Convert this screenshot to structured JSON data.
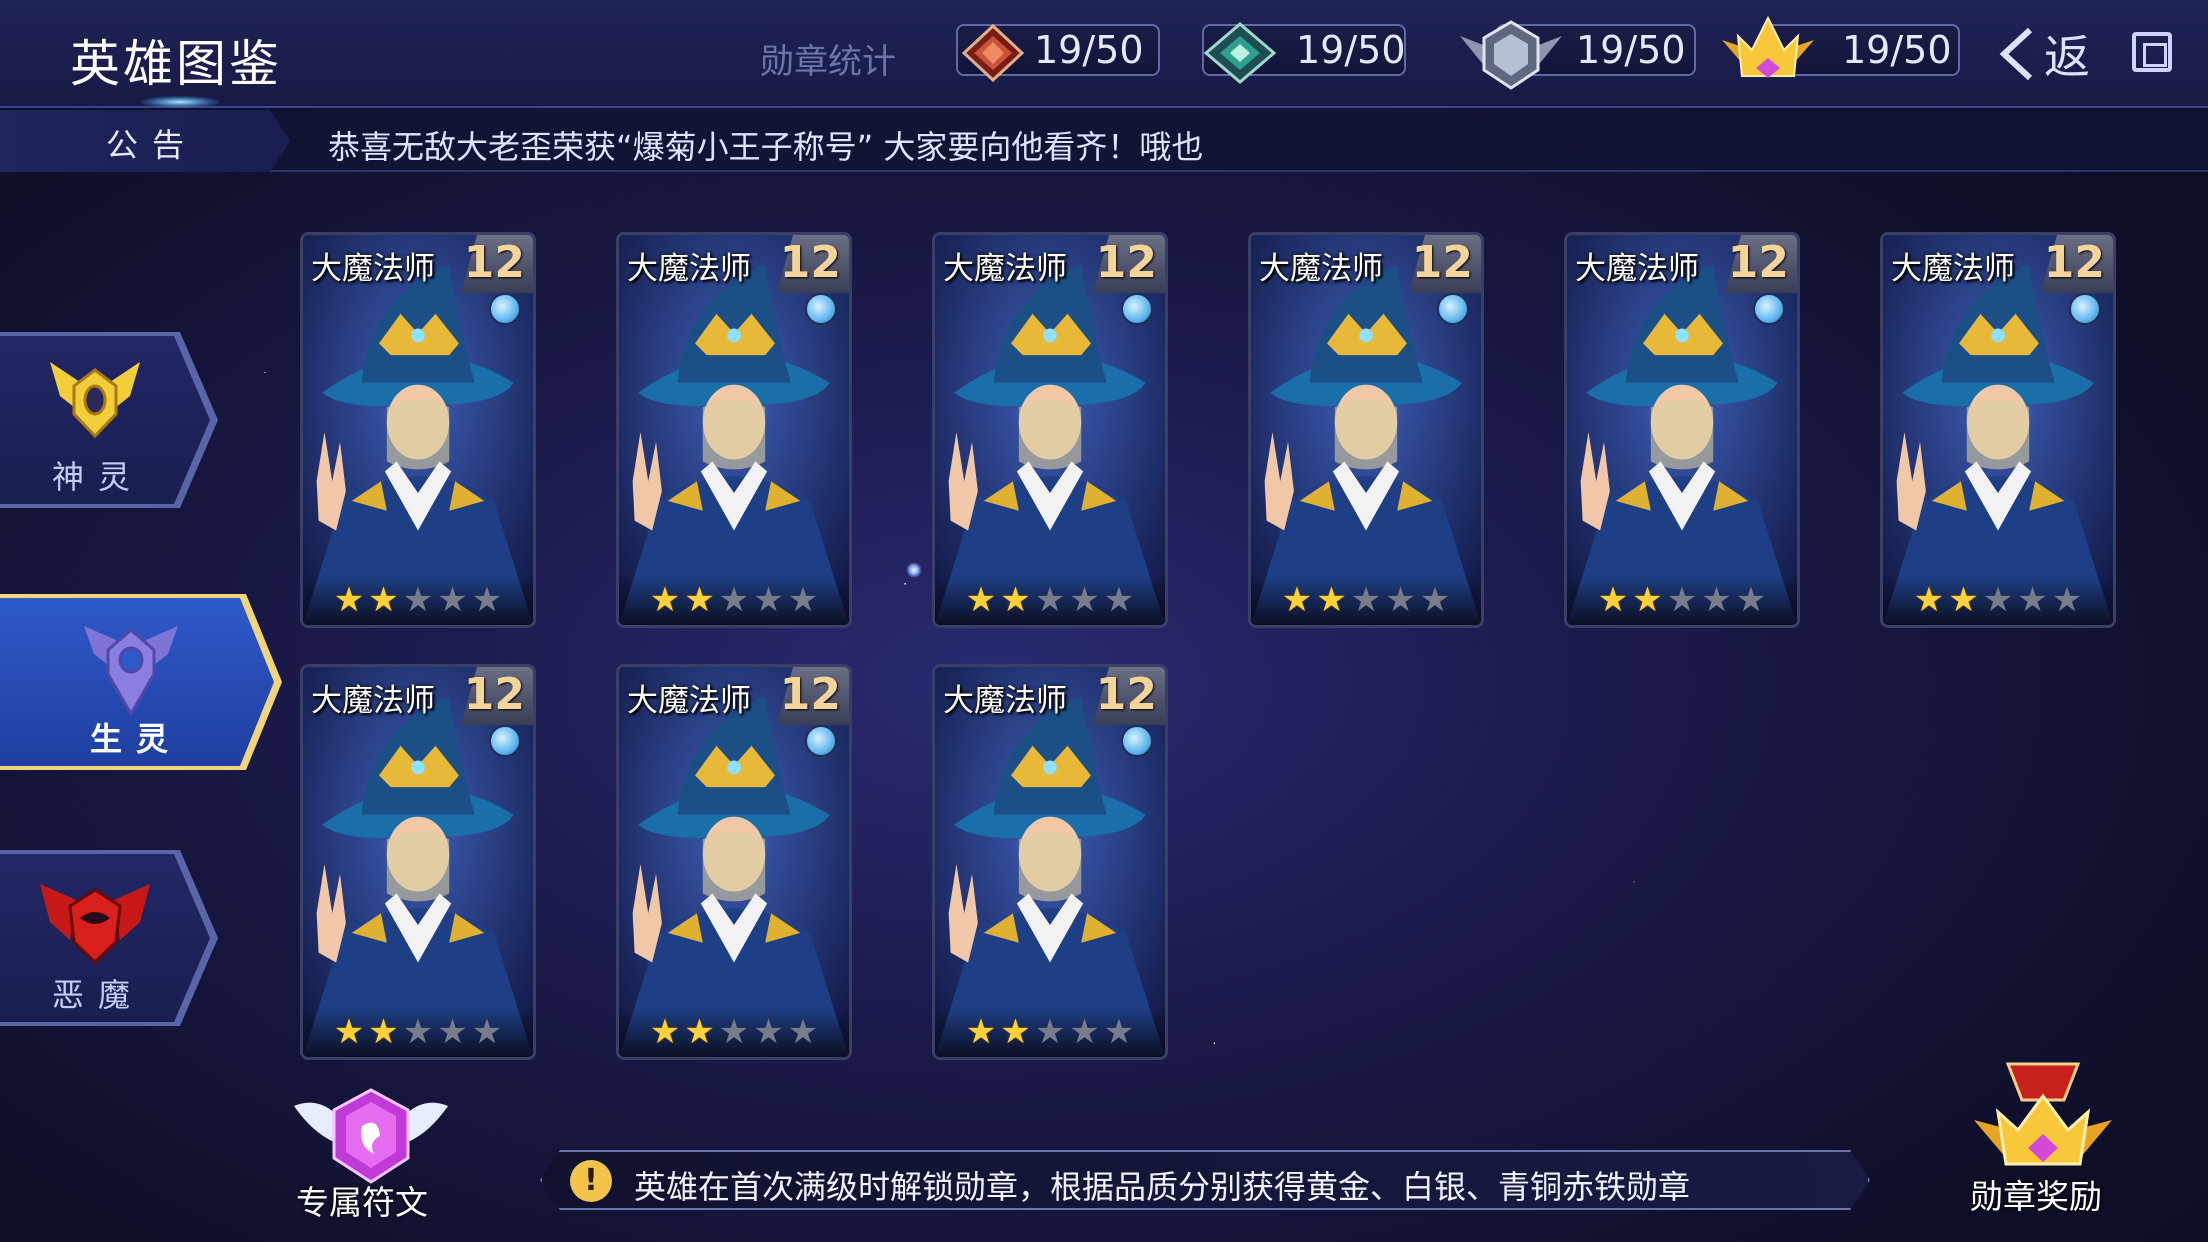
{
  "header": {
    "title": "英雄图鉴",
    "medal_stats_label": "勋章统计",
    "medals": [
      {
        "name": "iron-medal",
        "count": "19/50",
        "color": "#b8402e"
      },
      {
        "name": "bronze-medal",
        "count": "19/50",
        "color": "#2f9f8f"
      },
      {
        "name": "silver-medal",
        "count": "19/50",
        "color": "#9aa4b8"
      },
      {
        "name": "gold-medal",
        "count": "19/50",
        "color": "#f0c030"
      }
    ],
    "back_label": "返"
  },
  "notice": {
    "tag": "公告",
    "text": "恭喜无敌大老歪荣获“爆菊小王子称号”   大家要向他看齐！哦也"
  },
  "side_tabs": [
    {
      "label": "神灵",
      "icon": "god-emblem-icon",
      "color": "#f2cf3a",
      "active": false
    },
    {
      "label": "生灵",
      "icon": "creature-emblem-icon",
      "color": "#8a7fe0",
      "active": true
    },
    {
      "label": "恶魔",
      "icon": "demon-emblem-icon",
      "color": "#d8201c",
      "active": false
    }
  ],
  "heroes": [
    {
      "name": "大魔法师",
      "level": "12",
      "stars": 2,
      "max_stars": 5
    },
    {
      "name": "大魔法师",
      "level": "12",
      "stars": 2,
      "max_stars": 5
    },
    {
      "name": "大魔法师",
      "level": "12",
      "stars": 2,
      "max_stars": 5
    },
    {
      "name": "大魔法师",
      "level": "12",
      "stars": 2,
      "max_stars": 5
    },
    {
      "name": "大魔法师",
      "level": "12",
      "stars": 2,
      "max_stars": 5
    },
    {
      "name": "大魔法师",
      "level": "12",
      "stars": 2,
      "max_stars": 5
    },
    {
      "name": "大魔法师",
      "level": "12",
      "stars": 2,
      "max_stars": 5
    },
    {
      "name": "大魔法师",
      "level": "12",
      "stars": 2,
      "max_stars": 5
    },
    {
      "name": "大魔法师",
      "level": "12",
      "stars": 2,
      "max_stars": 5
    }
  ],
  "footer": {
    "rune_label": "专属符文",
    "tip_icon": "!",
    "tip_text": "英雄在首次满级时解锁勋章，根据品质分别获得黄金、白银、青铜赤铁勋章",
    "reward_label": "勋章奖励"
  }
}
